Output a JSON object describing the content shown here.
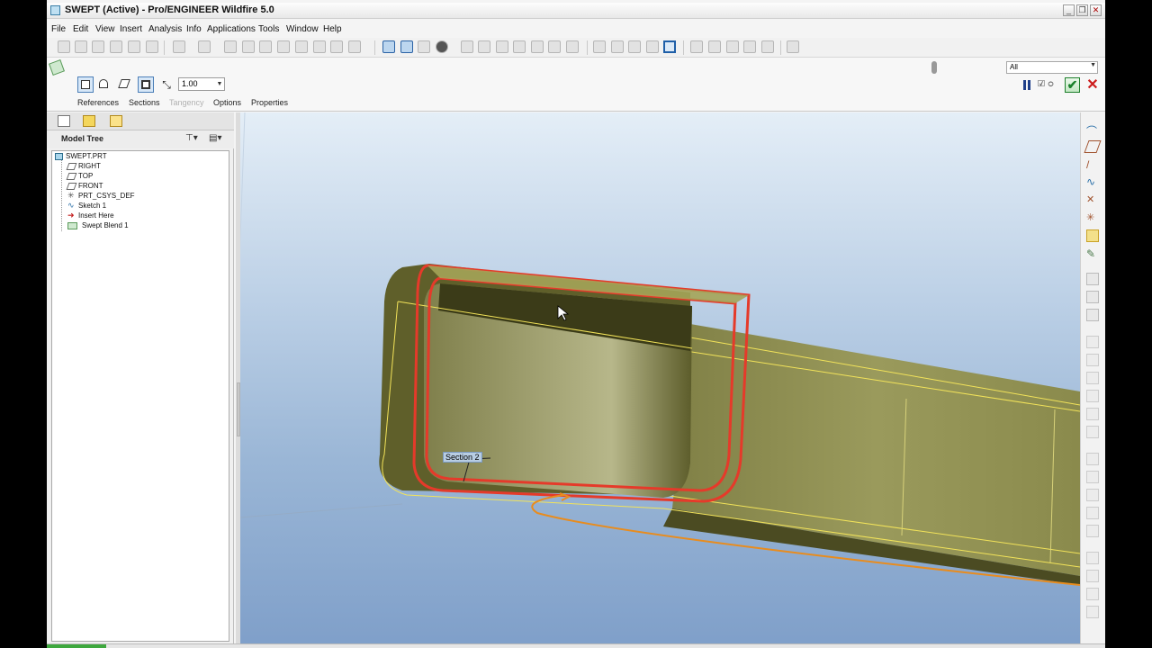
{
  "window": {
    "title": "SWEPT (Active) - Pro/ENGINEER Wildfire 5.0",
    "controls": [
      "minimize",
      "restore",
      "close"
    ]
  },
  "menu": [
    "File",
    "Edit",
    "View",
    "Insert",
    "Analysis",
    "Info",
    "Applications",
    "Tools",
    "Window",
    "Help"
  ],
  "dashboard": {
    "scale_value": "1.00",
    "tabs": [
      "References",
      "Sections",
      "Tangency",
      "Options",
      "Properties"
    ],
    "disabled_tab": "Tangency",
    "filter_value": "All",
    "colors": {
      "ok": "#19802a",
      "cancel": "#cc1b1b",
      "accent": "#1f5fa8"
    }
  },
  "model_tree": {
    "title": "Model Tree",
    "items": [
      {
        "label": "SWEPT.PRT",
        "icon": "part-icon"
      },
      {
        "label": "RIGHT",
        "icon": "datum-plane-icon"
      },
      {
        "label": "TOP",
        "icon": "datum-plane-icon"
      },
      {
        "label": "FRONT",
        "icon": "datum-plane-icon"
      },
      {
        "label": "PRT_CSYS_DEF",
        "icon": "coordinate-system-icon"
      },
      {
        "label": "Sketch 1",
        "icon": "sketch-icon"
      },
      {
        "label": "Insert Here",
        "icon": "insert-arrow-icon"
      },
      {
        "label": "Swept Blend 1",
        "icon": "swept-blend-icon"
      }
    ]
  },
  "graphics": {
    "annotation": "Section 2",
    "colors": {
      "solid": "#6b6b2c",
      "section_highlight": "#e53a2a",
      "trajectory": "#e88c1e",
      "edges": "#f2e35a"
    }
  }
}
